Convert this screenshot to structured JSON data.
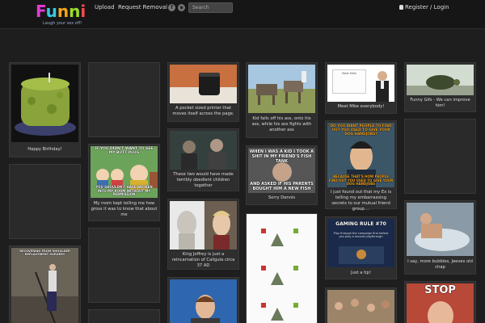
{
  "header": {
    "logo_text": [
      "F",
      "u",
      "n",
      "n",
      "i"
    ],
    "tagline": "Laugh your ass off!",
    "nav": {
      "upload": "Upload",
      "request_removal": "Request Removal"
    },
    "search_placeholder": "Search",
    "register_login": "Register / Login"
  },
  "cards": {
    "birthday": "Happy Birthday!",
    "printer": "A pocket sized printer that moves itself across the page.",
    "donkey": "Kid falls off his ass, onto his ass, while his ass fights with another ass",
    "mike": "Meet Mike everybody!",
    "turtle": "Funny Gifs - We can improve him!",
    "mom": "My mom kept telling me how gross it was to know that about me",
    "terribly": "These two would have made terribly obedient children together",
    "dennis": "Sorry Dennis",
    "ex": "I just found out that my Ex is telling my embarrassing secrets to our mutual friend group....",
    "joffrey": "King Joffrey is just a reincarnation of Caligula circa 37 AD",
    "rule70": "Just a tip!",
    "bubbles": "I say, more bubbles, Jeeves old chap"
  },
  "memes": {
    "sp_top": "IF YOU DIDN'T WANT TO SEE MY BUTT PLUG",
    "sp_bottom": "YOU SHOULDN'T HAVE BROKEN INTO MY ROOM WITHOUT MY PERMISSION",
    "fish_top": "WHEN I WAS A KID I TOOK A SHIT IN MY FRIEND'S FISH TANK",
    "fish_bottom": "AND ASKED IF HIS PARENTS BOUGHT HIM A NEW FISH",
    "archer_top": "DO YOU WANT PEOPLE TO FIND OUT YOU USED TO GIVE YOUR DOG HANDJOBS?",
    "archer_bottom": "BECAUSE THAT'S HOW PEOPLE FIND OUT YOU USED TO GIVE YOUR DOG HANDJOBS",
    "gaming_title": "GAMING RULE #70",
    "gaming_body": "Play through the campaign first before you play a second playthrough",
    "stairs": "RECOVERING FROM SHOULDER REPLACEMENT SURGERY",
    "stop": "STOP",
    "mike_name": "Meet Mike"
  },
  "colors": {
    "bg": "#1e1e1e",
    "card": "#2e2e2e",
    "header": "#161616"
  }
}
